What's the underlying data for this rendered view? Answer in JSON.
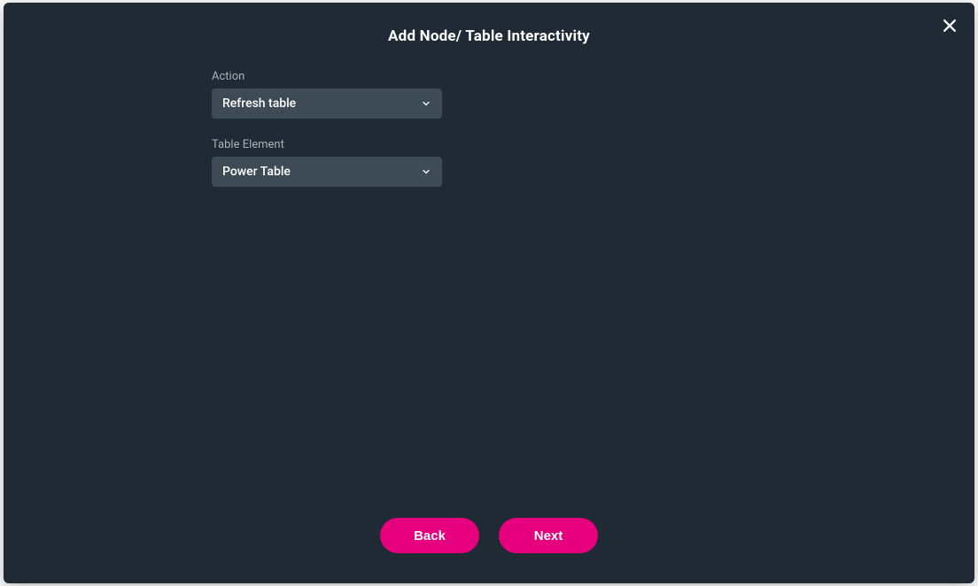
{
  "modal": {
    "title": "Add Node/ Table Interactivity"
  },
  "form": {
    "action": {
      "label": "Action",
      "value": "Refresh table"
    },
    "table_element": {
      "label": "Table Element",
      "value": "Power Table"
    }
  },
  "footer": {
    "back_label": "Back",
    "next_label": "Next"
  }
}
